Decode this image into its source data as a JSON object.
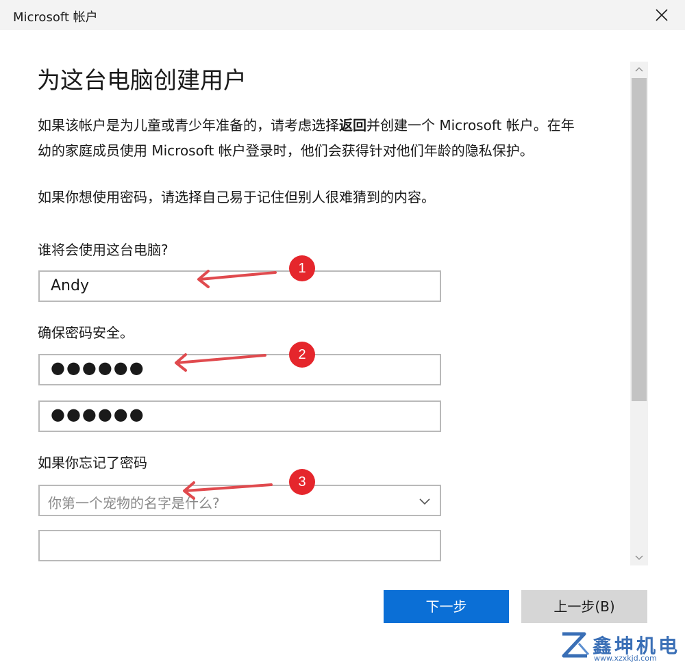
{
  "window": {
    "title": "Microsoft 帐户",
    "close_icon": "close-icon"
  },
  "page": {
    "heading": "为这台电脑创建用户",
    "paragraph1": {
      "before": "如果该帐户是为儿童或青少年准备的，请考虑选择",
      "bold": "返回",
      "after": "并创建一个 Microsoft 帐户。在年",
      "line2": "幼的家庭成员使用 Microsoft 帐户登录时，他们会获得针对他们年龄的隐私保护。"
    },
    "paragraph2": "如果你想使用密码，请选择自己易于记住但别人很难猜到的内容。"
  },
  "form": {
    "who_label": "谁将会使用这台电脑?",
    "username_value": "Andy",
    "password_label": "确保密码安全。",
    "password_value": "●●●●●●",
    "confirm_password_value": "●●●●●●",
    "forgot_label": "如果你忘记了密码",
    "security_question_placeholder": "你第一个宠物的名字是什么?",
    "answer_value": ""
  },
  "buttons": {
    "next": "下一步",
    "back": "上一步(B)"
  },
  "annotations": {
    "badge1": "1",
    "badge2": "2",
    "badge3": "3",
    "color": "#e5262c"
  },
  "watermark": {
    "text": "鑫坤机电",
    "url": "www.xzxkjd.com",
    "color": "#3a6fb6"
  },
  "colors": {
    "accent": "#0b6fd6",
    "titlebar_bg": "#f3f3f3",
    "field_border": "#b9b9b9"
  }
}
